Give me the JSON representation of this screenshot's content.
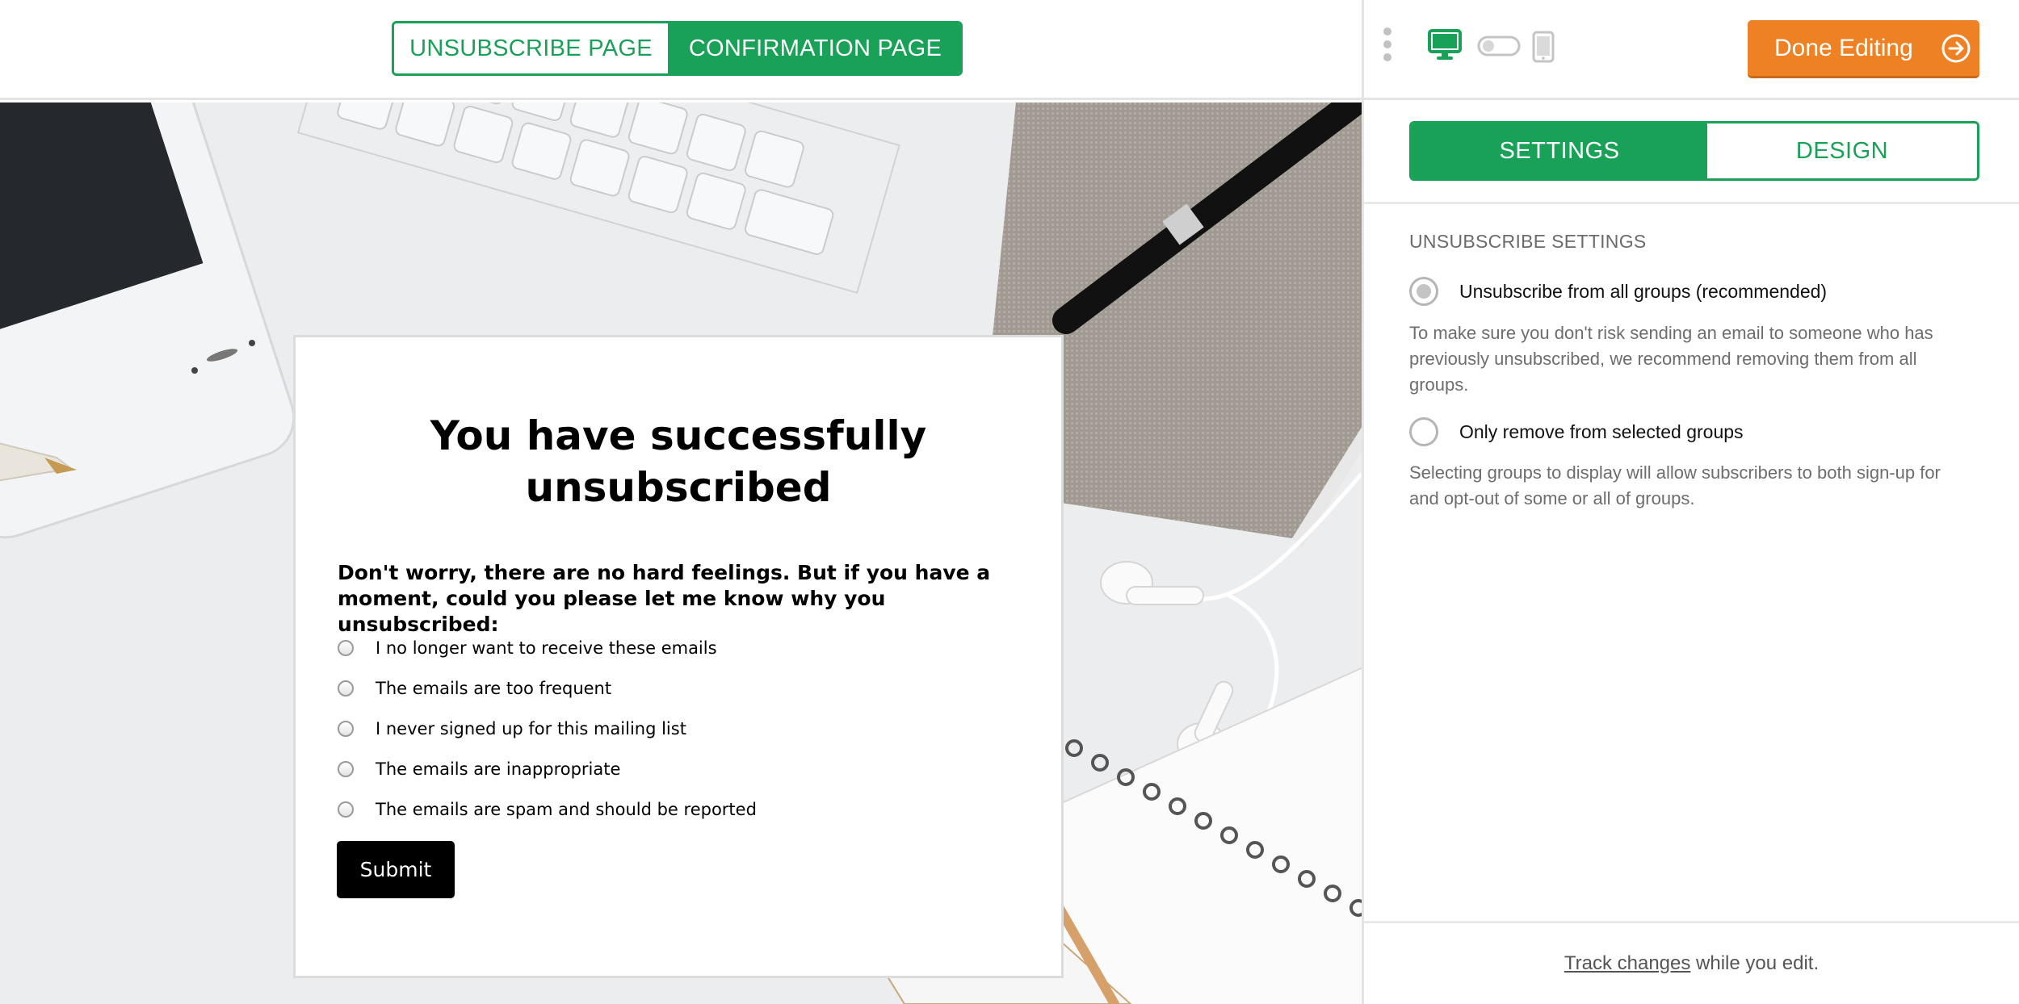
{
  "top_bar": {
    "tabs": [
      {
        "label": "UNSUBSCRIBE PAGE",
        "active": false
      },
      {
        "label": "CONFIRMATION PAGE",
        "active": true
      }
    ]
  },
  "form": {
    "title": "You have successfully unsubscribed",
    "question": "Don't worry, there are no hard feelings. But if you have a moment, could you please let me know why you unsubscribed:",
    "options": [
      "I no longer want to receive these emails",
      "The emails are too frequent",
      "I never signed up for this mailing list",
      "The emails are inappropriate",
      "The emails are spam and should be reported"
    ],
    "submit_label": "Submit"
  },
  "panel": {
    "device_icons": [
      "desktop-icon",
      "toggle-icon",
      "mobile-icon"
    ],
    "done_label": "Done Editing",
    "mode_tabs": [
      {
        "label": "SETTINGS",
        "active": true
      },
      {
        "label": "DESIGN",
        "active": false
      }
    ],
    "section_title": "UNSUBSCRIBE SETTINGS",
    "choices": [
      {
        "label": "Unsubscribe from all groups (recommended)",
        "checked": true,
        "help": "To make sure you don't risk sending an email to someone who has previously unsubscribed, we recommend removing them from all groups."
      },
      {
        "label": "Only remove from selected groups",
        "checked": false,
        "help": "Selecting groups to display will allow subscribers to both sign-up for and opt-out of some or all of groups."
      }
    ],
    "footer": {
      "link": "Track changes",
      "rest": " while you edit."
    }
  },
  "colors": {
    "brand_green": "#1aa158",
    "done_orange": "#ef8125"
  }
}
